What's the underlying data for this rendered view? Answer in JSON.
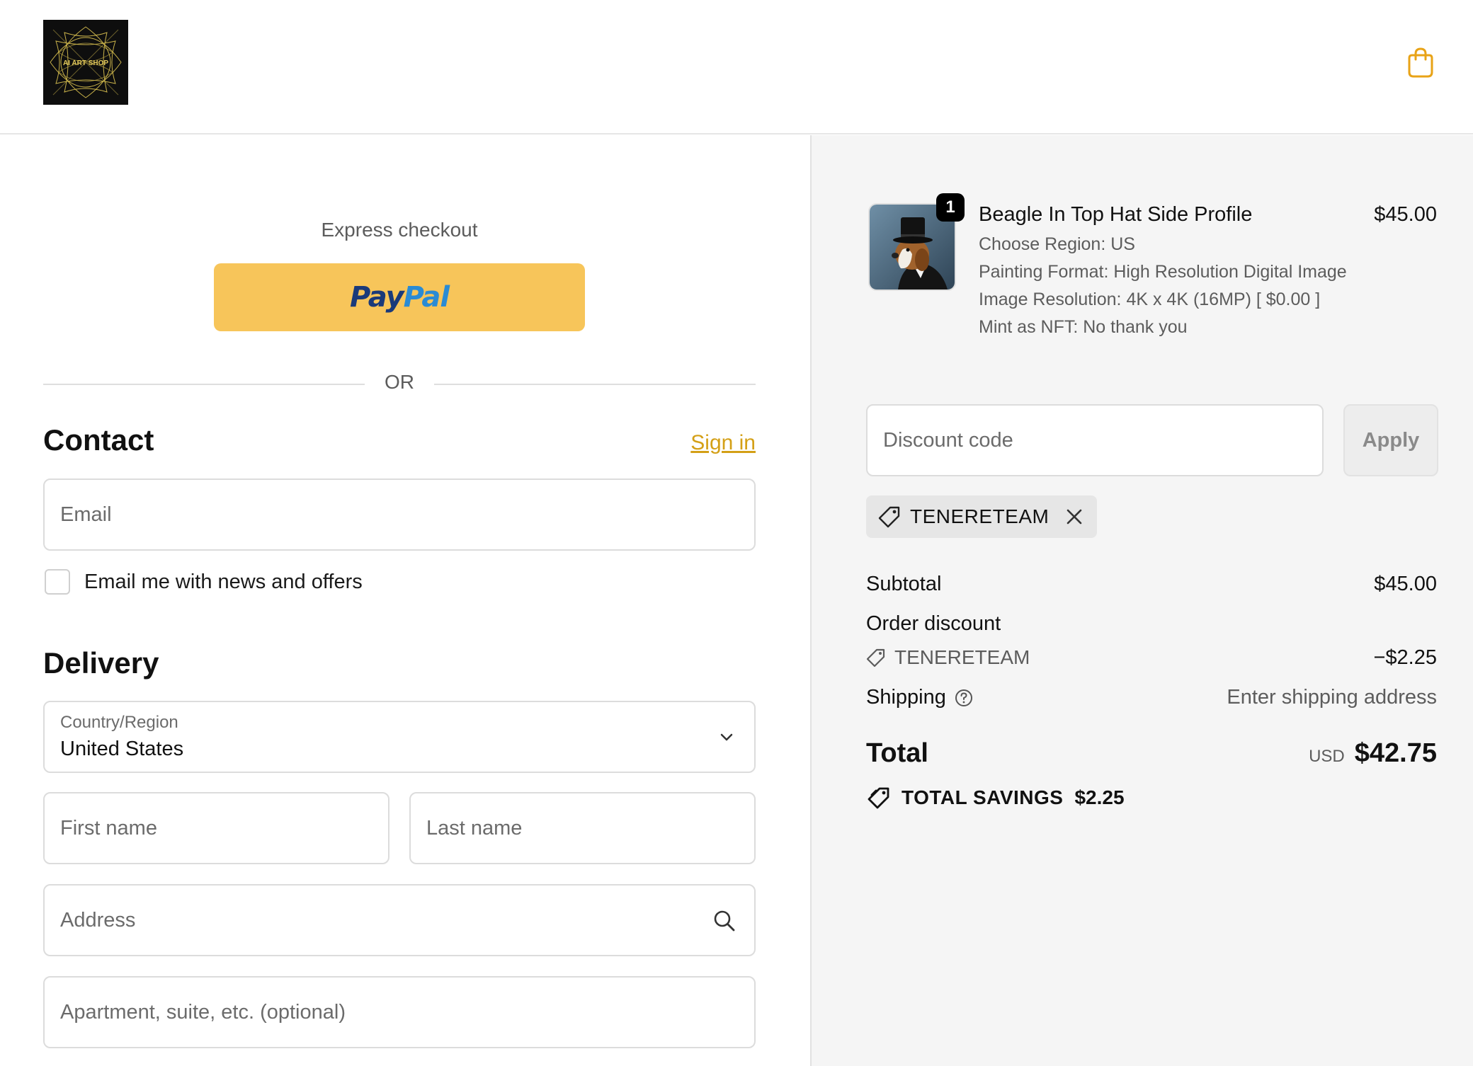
{
  "header": {
    "logo_text": "AI ART SHOP",
    "cart_icon": "shopping-bag-icon"
  },
  "checkout": {
    "express_label": "Express checkout",
    "paypal_pay": "Pay",
    "paypal_pal": "Pal",
    "or_text": "OR",
    "contact_title": "Contact",
    "sign_in": "Sign in",
    "email_placeholder": "Email",
    "news_label": "Email me with news and offers",
    "delivery_title": "Delivery",
    "country_label": "Country/Region",
    "country_value": "United States",
    "first_name_placeholder": "First name",
    "last_name_placeholder": "Last name",
    "address_placeholder": "Address",
    "apartment_placeholder": "Apartment, suite, etc. (optional)"
  },
  "summary": {
    "product": {
      "title": "Beagle In Top Hat Side Profile",
      "price": "$45.00",
      "quantity": "1",
      "options": [
        "Choose Region: US",
        "Painting Format: High Resolution Digital Image",
        "Image Resolution: 4K x 4K (16MP) [ $0.00 ]",
        "Mint as NFT: No thank you"
      ]
    },
    "discount_placeholder": "Discount code",
    "apply_label": "Apply",
    "applied_code": "TENERETEAM",
    "subtotal_label": "Subtotal",
    "subtotal_value": "$45.00",
    "order_discount_label": "Order discount",
    "discount_code": "TENERETEAM",
    "discount_value": "−$2.25",
    "shipping_label": "Shipping",
    "shipping_value": "Enter shipping address",
    "total_label": "Total",
    "currency": "USD",
    "total_value": "$42.75",
    "savings_label": "TOTAL SAVINGS",
    "savings_value": "$2.25"
  },
  "colors": {
    "accent": "#d4a017",
    "paypal_yellow": "#f7c55a",
    "paypal_dark": "#1a3a7a",
    "paypal_light": "#2a8bd4",
    "cart_orange": "#e8a317"
  }
}
